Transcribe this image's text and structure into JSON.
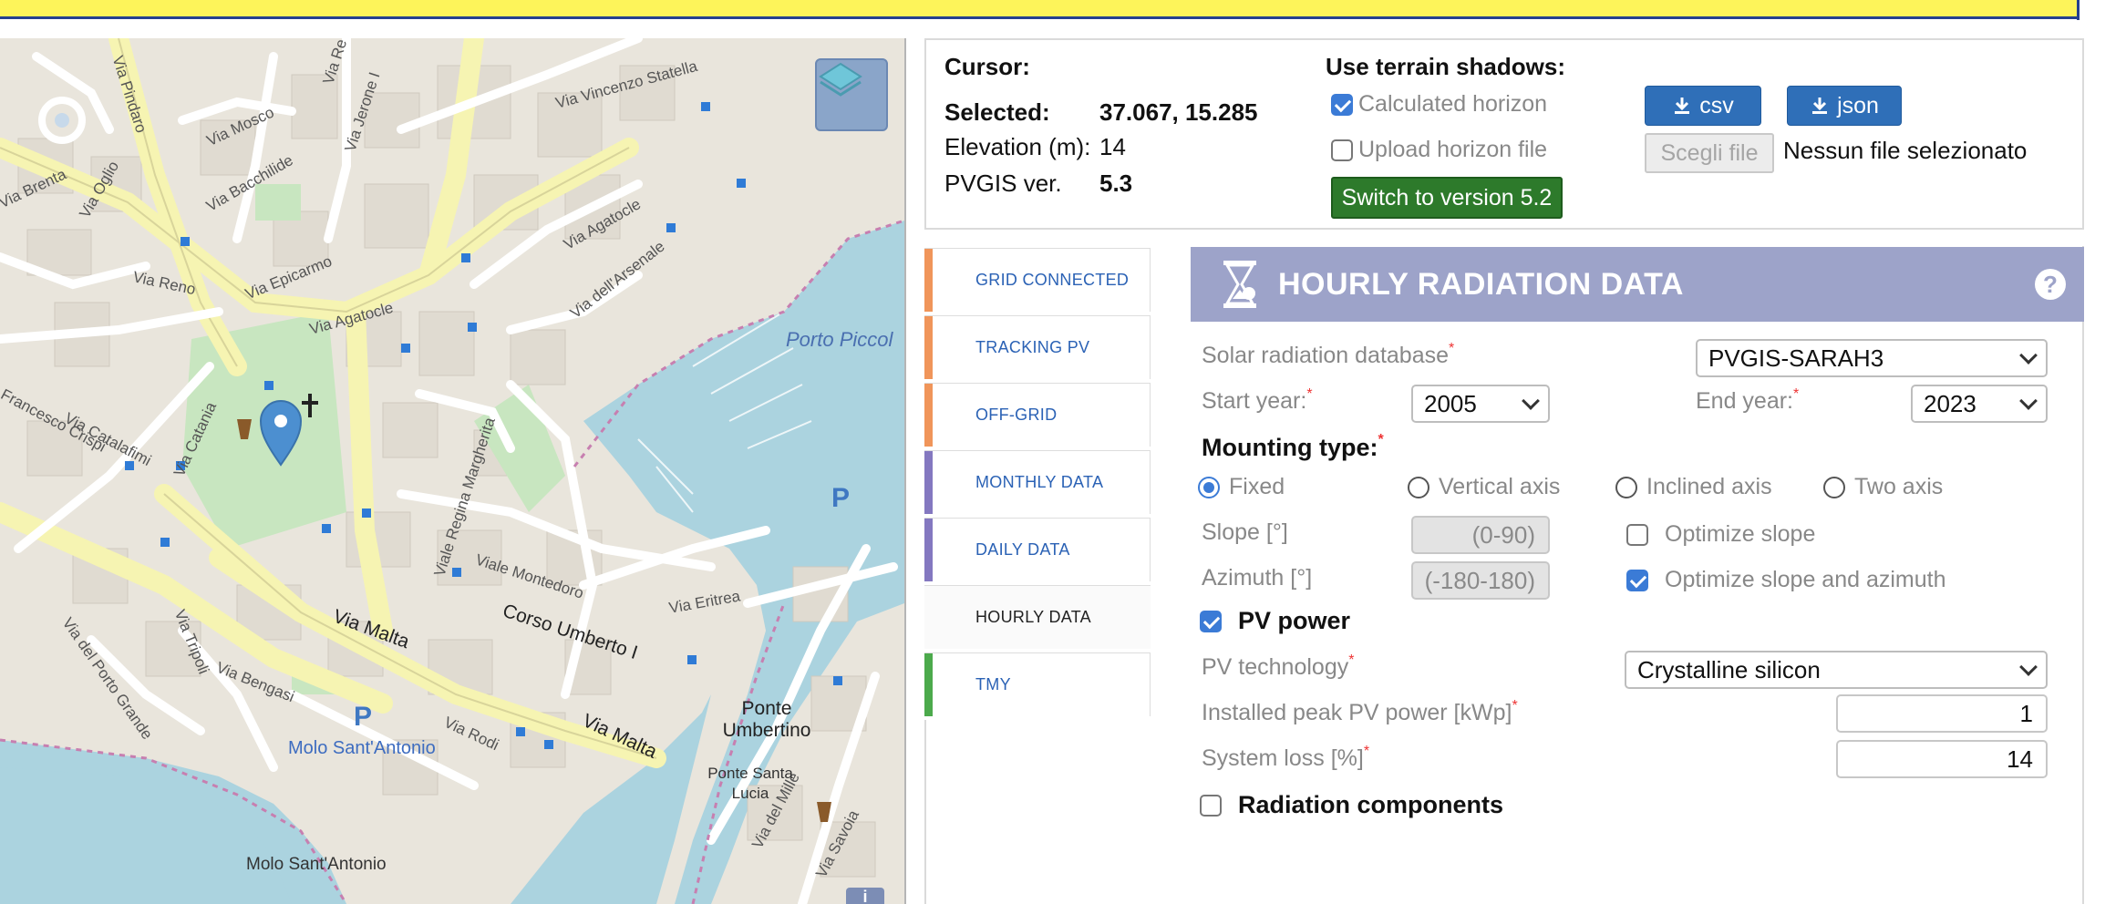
{
  "map": {
    "street_labels": [
      "Via Pindaro",
      "Via Re Jerone II",
      "Via Vincenzo Statella",
      "Via Mosco",
      "Via Jerone I",
      "Via Bacchilide",
      "Via Brenta",
      "Via Oglio",
      "Via Reno",
      "Via Epicarmo",
      "Via Agatocle",
      "Via dell'Arsenale",
      "Via Agatocle",
      "Francesco Crispi",
      "Via Catalafimi",
      "Via Catania",
      "Viale Regina Margherita",
      "Viale Montedoro",
      "Corso Umberto I",
      "Via Malta",
      "Via Eritrea",
      "Via del Porto Grande",
      "Via Tripoli",
      "Via Bengasi",
      "Via Rodi",
      "Via Malta",
      "Via del Mille",
      "Via Savoia"
    ],
    "place_labels": {
      "porto_piccolo": "Porto Piccol",
      "ponte_umbertino": "Ponte Umbertino",
      "ponte_santa_lucia": "Ponte Santa Lucia",
      "molo_blue": "Molo Sant'Antonio",
      "molo_gray": "Molo Sant'Antonio",
      "parking": "P"
    },
    "info_button": "i"
  },
  "info": {
    "cursor_label": "Cursor:",
    "selected_label": "Selected:",
    "selected_value": "37.067, 15.285",
    "elevation_label": "Elevation (m):",
    "elevation_value": "14",
    "pvgis_label": "PVGIS ver.",
    "pvgis_value": "5.3",
    "terrain_title": "Use terrain shadows:",
    "calculated_horizon": "Calculated horizon",
    "calculated_horizon_checked": true,
    "upload_horizon": "Upload horizon file",
    "upload_horizon_checked": false,
    "switch_version": "Switch to version 5.2",
    "csv_label": "csv",
    "json_label": "json",
    "choose_file": "Scegli file",
    "no_file": "Nessun file selezionato"
  },
  "tabs": [
    {
      "label": "GRID CONNECTED",
      "color": "#f0955a"
    },
    {
      "label": "TRACKING PV",
      "color": "#f0955a"
    },
    {
      "label": "OFF-GRID",
      "color": "#f0955a"
    },
    {
      "label": "MONTHLY DATA",
      "color": "#8478c0"
    },
    {
      "label": "DAILY DATA",
      "color": "#8478c0"
    },
    {
      "label": "HOURLY DATA",
      "color": "#ffffff"
    },
    {
      "label": "TMY",
      "color": "#4caa4c"
    }
  ],
  "form": {
    "title": "HOURLY RADIATION DATA",
    "help": "?",
    "solar_db_label": "Solar radiation database",
    "solar_db_value": "PVGIS-SARAH3",
    "start_year_label": "Start year:",
    "start_year_value": "2005",
    "end_year_label": "End year:",
    "end_year_value": "2023",
    "mounting_label": "Mounting type:",
    "mounting_options": [
      "Fixed",
      "Vertical axis",
      "Inclined axis",
      "Two axis"
    ],
    "mounting_selected": "Fixed",
    "slope_label": "Slope [°]",
    "slope_placeholder": "(0-90)",
    "azimuth_label": "Azimuth [°]",
    "azimuth_placeholder": "(-180-180)",
    "optimize_slope": "Optimize slope",
    "optimize_slope_checked": false,
    "optimize_both": "Optimize slope and azimuth",
    "optimize_both_checked": true,
    "pv_power": "PV power",
    "pv_power_checked": true,
    "pv_tech_label": "PV technology",
    "pv_tech_value": "Crystalline silicon",
    "peak_power_label": "Installed peak PV power [kWp]",
    "peak_power_value": "1",
    "system_loss_label": "System loss [%]",
    "system_loss_value": "14",
    "radiation_components": "Radiation components",
    "radiation_components_checked": false,
    "required_mark": "*"
  },
  "colors": {
    "header_bg": "#9da3c9",
    "accent_blue": "#2f6fb8",
    "accent_green": "#2d7a2b",
    "topbar": "#fdf45a"
  }
}
